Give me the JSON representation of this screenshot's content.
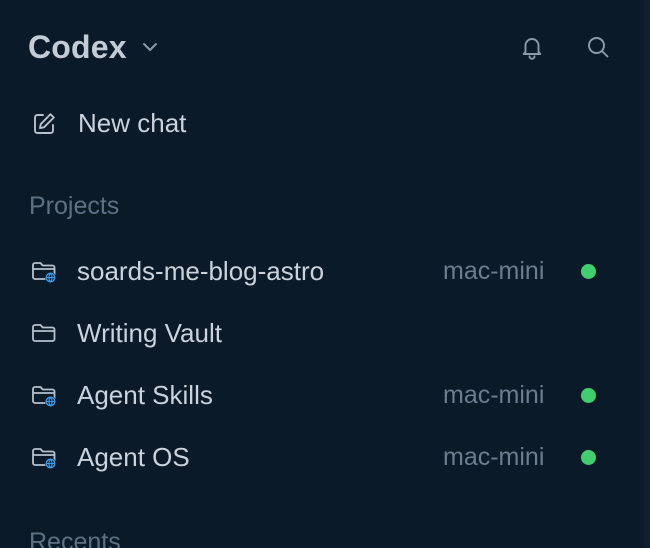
{
  "app": {
    "title": "Codex"
  },
  "header": {
    "notifications_icon": "bell-icon",
    "search_icon": "search-icon"
  },
  "new_chat": {
    "label": "New chat",
    "icon": "edit-icon"
  },
  "sections": {
    "projects": "Projects",
    "recents": "Recents"
  },
  "projects": [
    {
      "name": "soards-me-blog-astro",
      "host": "mac-mini",
      "remote": true,
      "online": true
    },
    {
      "name": "Writing Vault",
      "host": "",
      "remote": false,
      "online": false
    },
    {
      "name": "Agent Skills",
      "host": "mac-mini",
      "remote": true,
      "online": true
    },
    {
      "name": "Agent OS",
      "host": "mac-mini",
      "remote": true,
      "online": true
    }
  ],
  "colors": {
    "background": "#0b1a29",
    "online": "#3fcf6e",
    "globe": "#3d9be9"
  }
}
